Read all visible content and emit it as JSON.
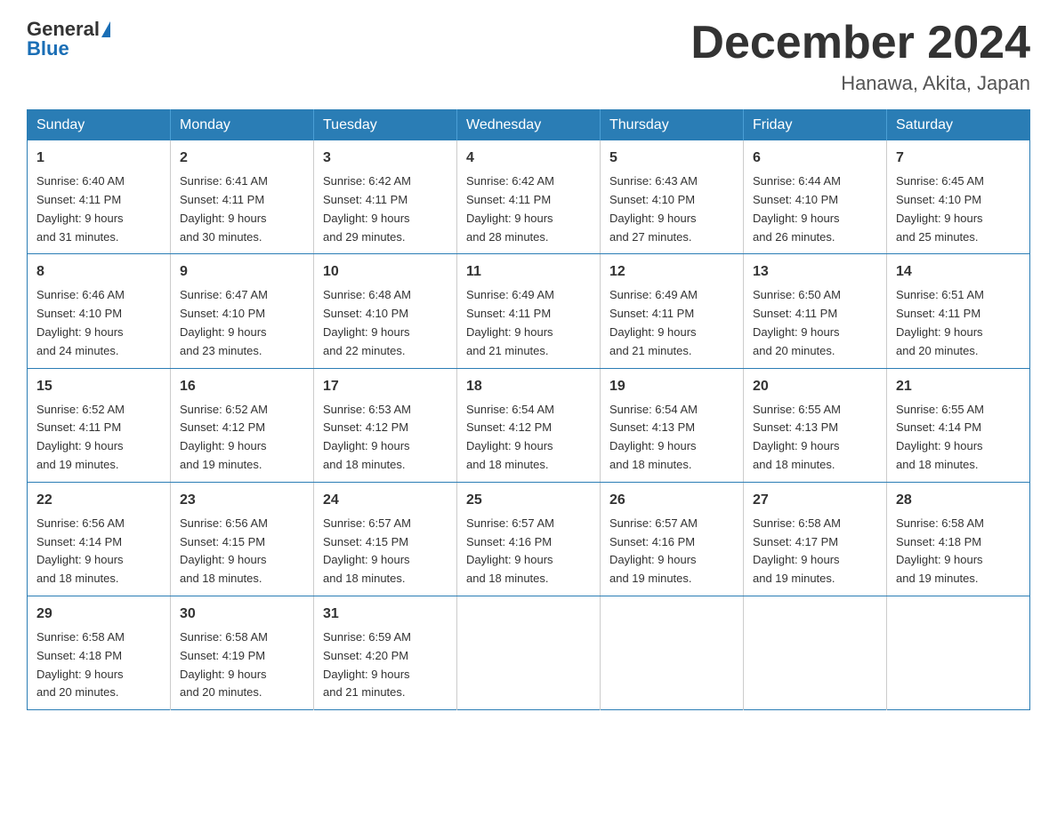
{
  "logo": {
    "general": "General",
    "blue": "Blue"
  },
  "title": {
    "month": "December 2024",
    "location": "Hanawa, Akita, Japan"
  },
  "headers": [
    "Sunday",
    "Monday",
    "Tuesday",
    "Wednesday",
    "Thursday",
    "Friday",
    "Saturday"
  ],
  "weeks": [
    [
      {
        "day": "1",
        "sunrise": "6:40 AM",
        "sunset": "4:11 PM",
        "daylight": "9 hours and 31 minutes."
      },
      {
        "day": "2",
        "sunrise": "6:41 AM",
        "sunset": "4:11 PM",
        "daylight": "9 hours and 30 minutes."
      },
      {
        "day": "3",
        "sunrise": "6:42 AM",
        "sunset": "4:11 PM",
        "daylight": "9 hours and 29 minutes."
      },
      {
        "day": "4",
        "sunrise": "6:42 AM",
        "sunset": "4:11 PM",
        "daylight": "9 hours and 28 minutes."
      },
      {
        "day": "5",
        "sunrise": "6:43 AM",
        "sunset": "4:10 PM",
        "daylight": "9 hours and 27 minutes."
      },
      {
        "day": "6",
        "sunrise": "6:44 AM",
        "sunset": "4:10 PM",
        "daylight": "9 hours and 26 minutes."
      },
      {
        "day": "7",
        "sunrise": "6:45 AM",
        "sunset": "4:10 PM",
        "daylight": "9 hours and 25 minutes."
      }
    ],
    [
      {
        "day": "8",
        "sunrise": "6:46 AM",
        "sunset": "4:10 PM",
        "daylight": "9 hours and 24 minutes."
      },
      {
        "day": "9",
        "sunrise": "6:47 AM",
        "sunset": "4:10 PM",
        "daylight": "9 hours and 23 minutes."
      },
      {
        "day": "10",
        "sunrise": "6:48 AM",
        "sunset": "4:10 PM",
        "daylight": "9 hours and 22 minutes."
      },
      {
        "day": "11",
        "sunrise": "6:49 AM",
        "sunset": "4:11 PM",
        "daylight": "9 hours and 21 minutes."
      },
      {
        "day": "12",
        "sunrise": "6:49 AM",
        "sunset": "4:11 PM",
        "daylight": "9 hours and 21 minutes."
      },
      {
        "day": "13",
        "sunrise": "6:50 AM",
        "sunset": "4:11 PM",
        "daylight": "9 hours and 20 minutes."
      },
      {
        "day": "14",
        "sunrise": "6:51 AM",
        "sunset": "4:11 PM",
        "daylight": "9 hours and 20 minutes."
      }
    ],
    [
      {
        "day": "15",
        "sunrise": "6:52 AM",
        "sunset": "4:11 PM",
        "daylight": "9 hours and 19 minutes."
      },
      {
        "day": "16",
        "sunrise": "6:52 AM",
        "sunset": "4:12 PM",
        "daylight": "9 hours and 19 minutes."
      },
      {
        "day": "17",
        "sunrise": "6:53 AM",
        "sunset": "4:12 PM",
        "daylight": "9 hours and 18 minutes."
      },
      {
        "day": "18",
        "sunrise": "6:54 AM",
        "sunset": "4:12 PM",
        "daylight": "9 hours and 18 minutes."
      },
      {
        "day": "19",
        "sunrise": "6:54 AM",
        "sunset": "4:13 PM",
        "daylight": "9 hours and 18 minutes."
      },
      {
        "day": "20",
        "sunrise": "6:55 AM",
        "sunset": "4:13 PM",
        "daylight": "9 hours and 18 minutes."
      },
      {
        "day": "21",
        "sunrise": "6:55 AM",
        "sunset": "4:14 PM",
        "daylight": "9 hours and 18 minutes."
      }
    ],
    [
      {
        "day": "22",
        "sunrise": "6:56 AM",
        "sunset": "4:14 PM",
        "daylight": "9 hours and 18 minutes."
      },
      {
        "day": "23",
        "sunrise": "6:56 AM",
        "sunset": "4:15 PM",
        "daylight": "9 hours and 18 minutes."
      },
      {
        "day": "24",
        "sunrise": "6:57 AM",
        "sunset": "4:15 PM",
        "daylight": "9 hours and 18 minutes."
      },
      {
        "day": "25",
        "sunrise": "6:57 AM",
        "sunset": "4:16 PM",
        "daylight": "9 hours and 18 minutes."
      },
      {
        "day": "26",
        "sunrise": "6:57 AM",
        "sunset": "4:16 PM",
        "daylight": "9 hours and 19 minutes."
      },
      {
        "day": "27",
        "sunrise": "6:58 AM",
        "sunset": "4:17 PM",
        "daylight": "9 hours and 19 minutes."
      },
      {
        "day": "28",
        "sunrise": "6:58 AM",
        "sunset": "4:18 PM",
        "daylight": "9 hours and 19 minutes."
      }
    ],
    [
      {
        "day": "29",
        "sunrise": "6:58 AM",
        "sunset": "4:18 PM",
        "daylight": "9 hours and 20 minutes."
      },
      {
        "day": "30",
        "sunrise": "6:58 AM",
        "sunset": "4:19 PM",
        "daylight": "9 hours and 20 minutes."
      },
      {
        "day": "31",
        "sunrise": "6:59 AM",
        "sunset": "4:20 PM",
        "daylight": "9 hours and 21 minutes."
      },
      null,
      null,
      null,
      null
    ]
  ],
  "labels": {
    "sunrise": "Sunrise:",
    "sunset": "Sunset:",
    "daylight": "Daylight:"
  }
}
